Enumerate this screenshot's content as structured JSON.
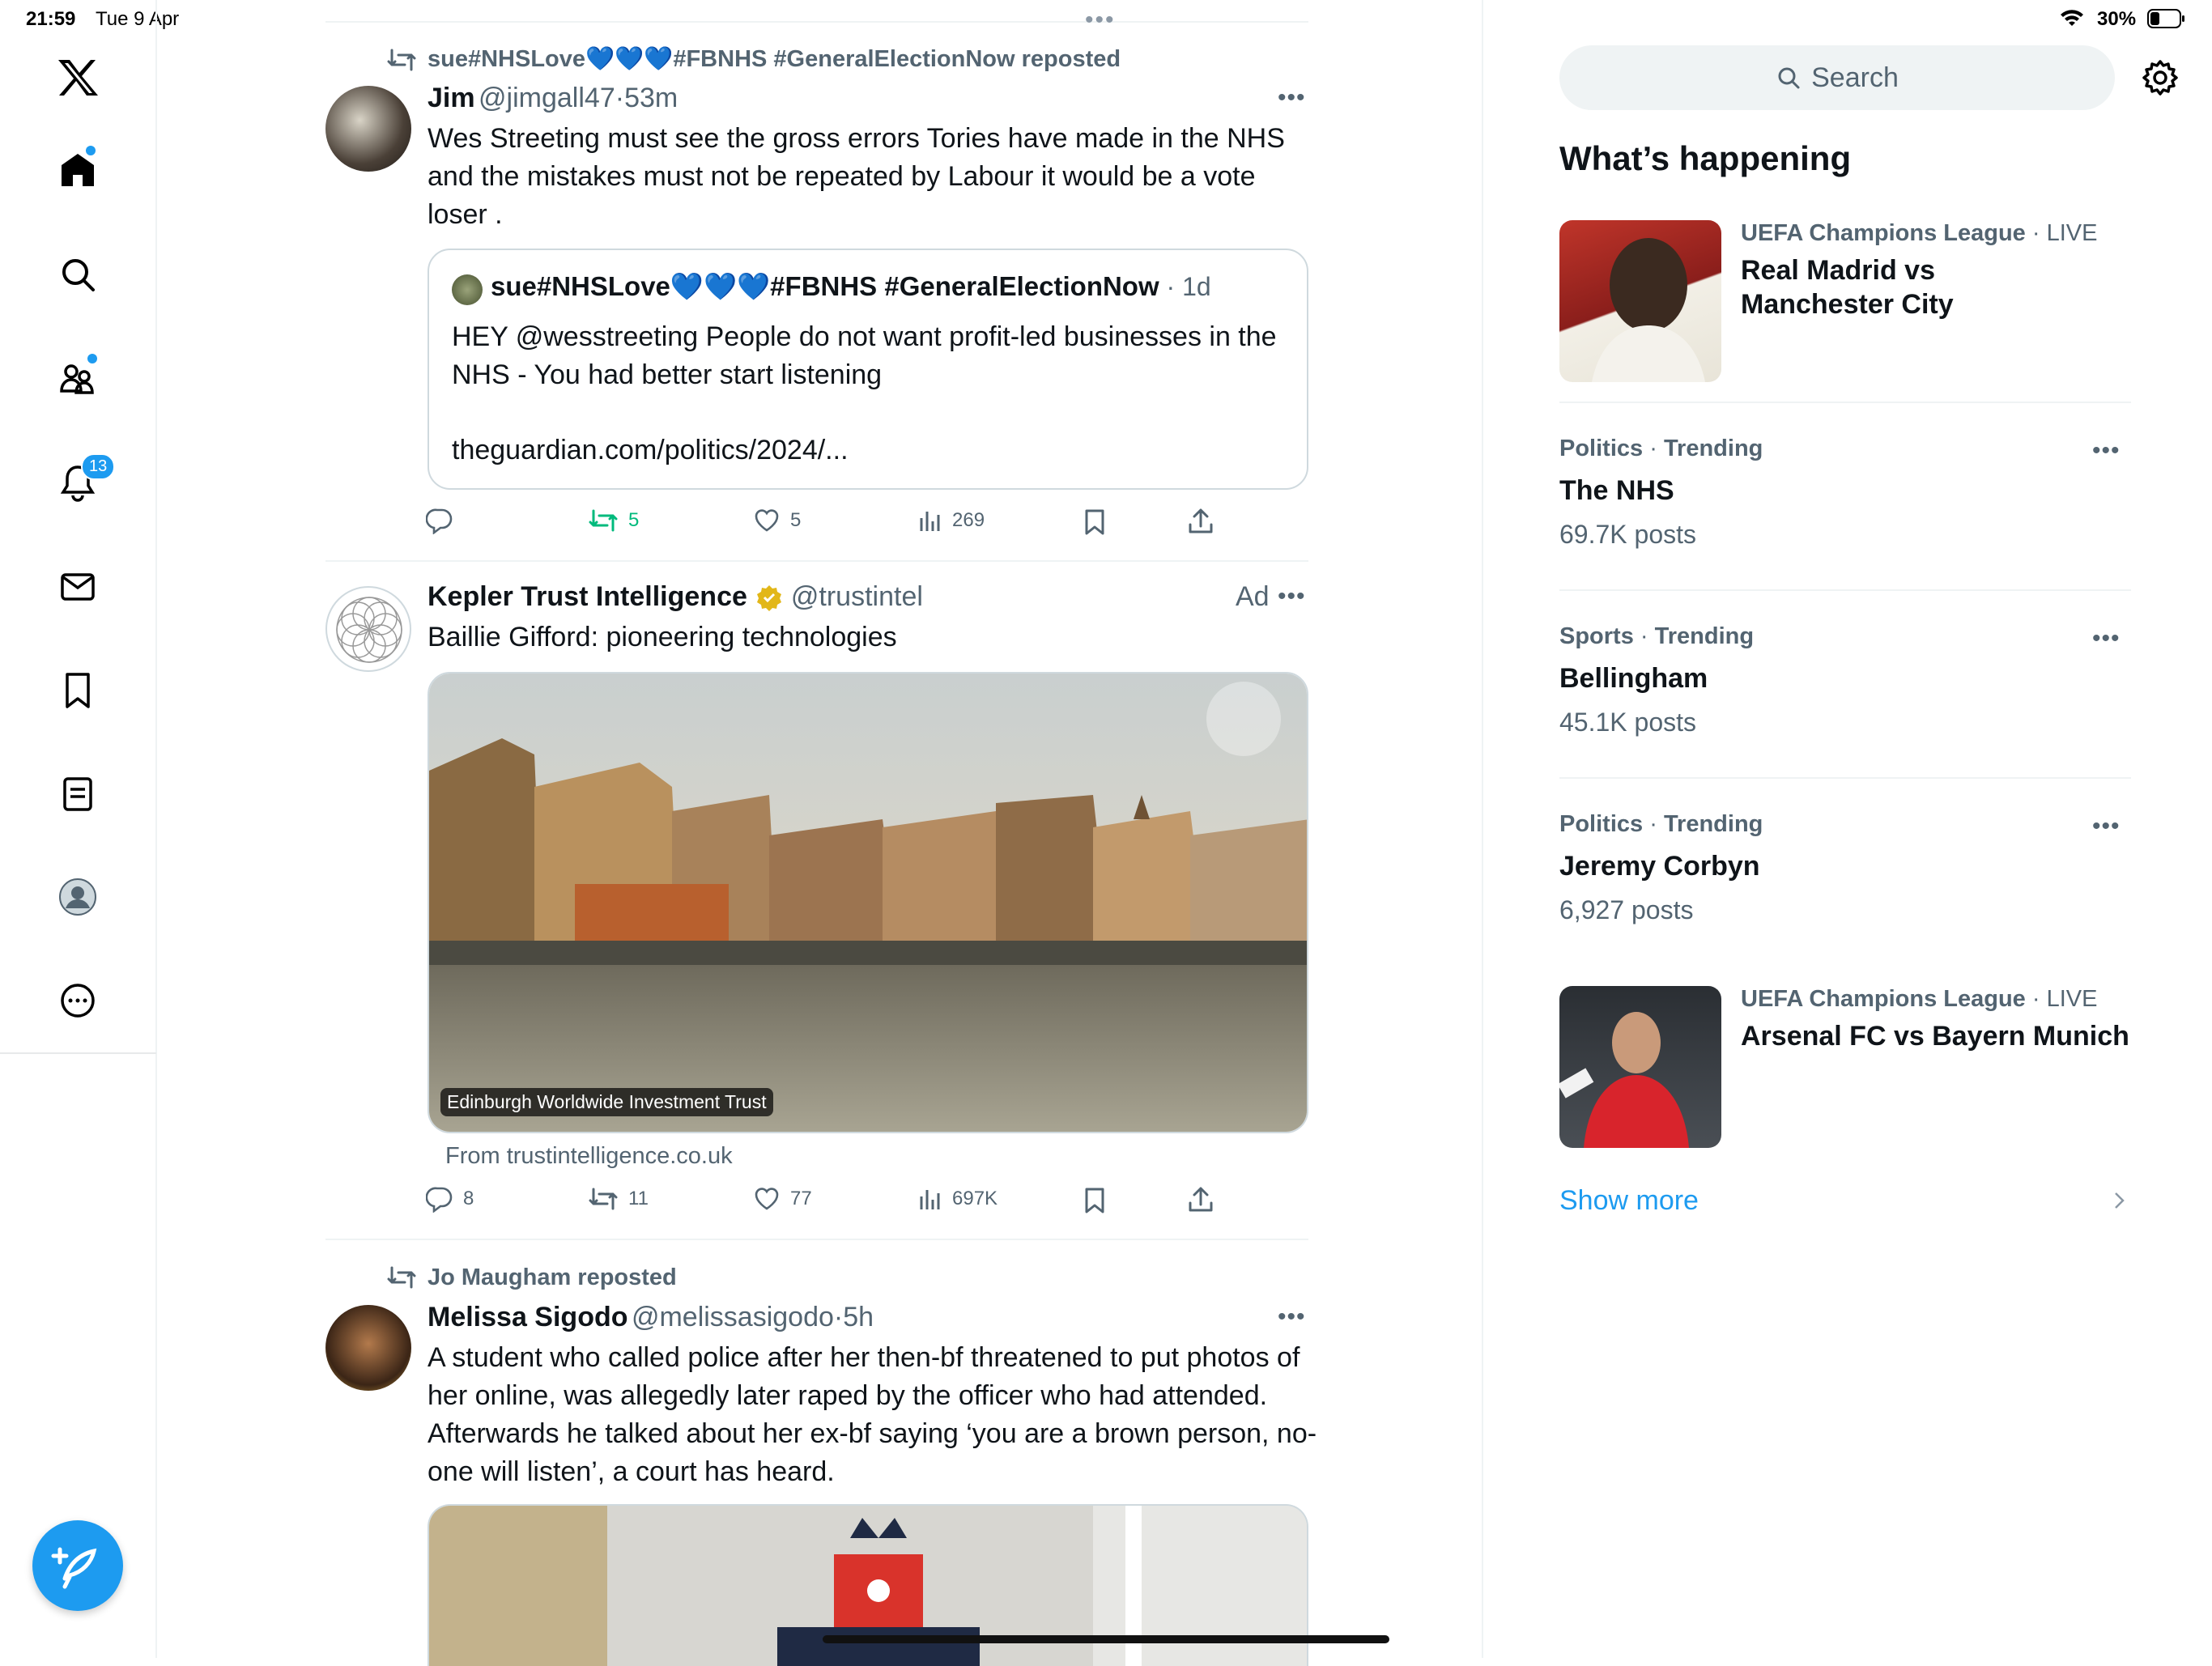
{
  "status_bar": {
    "time": "21:59",
    "date": "Tue 9 Apr",
    "battery": "30%"
  },
  "sidebar": {
    "notifications_count": "13"
  },
  "tweets": [
    {
      "repost_label": "sue#NHSLove💙💙💙#FBNHS #GeneralElectionNow reposted",
      "name": "Jim",
      "handle": "@jimgall47",
      "time": "53m",
      "text": "Wes Streeting must see the gross errors Tories have made in the NHS and the mistakes must not be repeated by Labour it would be a vote loser .",
      "quote": {
        "name": "sue#NHSLove💙💙💙#FBNHS #GeneralElectionNow",
        "time": "1d",
        "text": "HEY @wesstreeting People do not want profit-led businesses in the NHS - You had better start listening",
        "link": "theguardian.com/politics/2024/..."
      },
      "replies": "",
      "reposts": "5",
      "likes": "5",
      "views": "269"
    },
    {
      "name": "Kepler Trust Intelligence",
      "handle": "@trustintel",
      "ad_label": "Ad",
      "text": "Baillie Gifford: pioneering technologies",
      "image_caption": "Edinburgh Worldwide Investment Trust",
      "source": "From trustintelligence.co.uk",
      "replies": "8",
      "reposts": "11",
      "likes": "77",
      "views": "697K"
    },
    {
      "repost_label": "Jo Maugham reposted",
      "name": "Melissa Sigodo",
      "handle": "@melissasigodo",
      "time": "5h",
      "text": "A student who called police after her then-bf threatened to put photos of her online, was allegedly later raped by the officer who had attended. Afterwards he talked about her ex-bf saying ‘you are a brown person, no-one will listen’, a court has heard."
    }
  ],
  "right": {
    "search_placeholder": "Search",
    "heading": "What’s happening",
    "events": [
      {
        "category": "UEFA Champions League",
        "live": "LIVE",
        "title": "Real Madrid vs Manchester City"
      },
      {
        "category": "UEFA Champions League",
        "live": "LIVE",
        "title": "Arsenal FC vs Bayern Munich"
      }
    ],
    "trends": [
      {
        "category": "Politics",
        "trending": "Trending",
        "title": "The NHS",
        "posts": "69.7K posts"
      },
      {
        "category": "Sports",
        "trending": "Trending",
        "title": "Bellingham",
        "posts": "45.1K posts"
      },
      {
        "category": "Politics",
        "trending": "Trending",
        "title": "Jeremy Corbyn",
        "posts": "6,927 posts"
      }
    ],
    "show_more": "Show more"
  },
  "colors": {
    "accent": "#1d9bf0",
    "repost_green": "#00ba7c",
    "muted": "#536471"
  }
}
